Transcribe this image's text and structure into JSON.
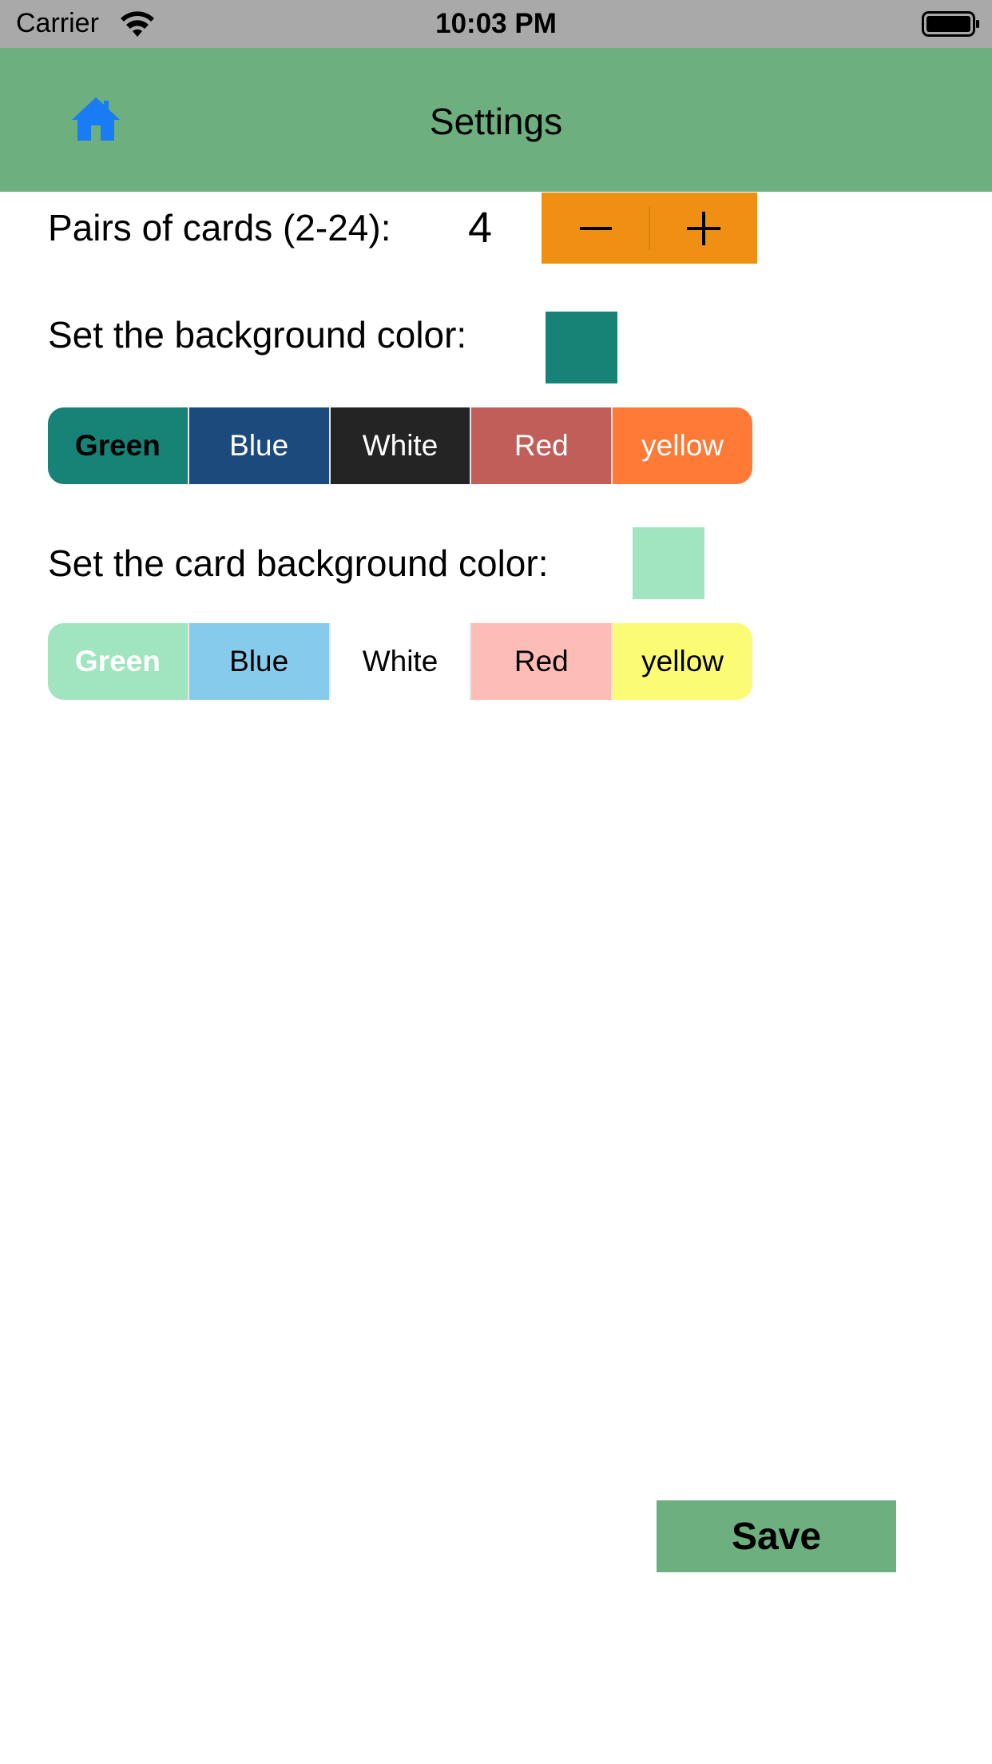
{
  "status_bar": {
    "carrier": "Carrier",
    "time": "10:03 PM",
    "wifi_icon": "wifi-icon",
    "battery_icon": "battery-icon"
  },
  "nav_bar": {
    "title": "Settings",
    "home_icon": "home-icon",
    "background": "#6daf7e",
    "home_icon_color": "#1a7cf5"
  },
  "pairs": {
    "label": "Pairs of cards (2-24):",
    "value": "4",
    "stepper_color": "#ef9014",
    "decrement_icon": "minus-icon",
    "increment_icon": "plus-icon"
  },
  "background_color": {
    "label": "Set the background color:",
    "preview_color": "#178276",
    "selected": "Green",
    "options": [
      {
        "label": "Green",
        "color": "#178276",
        "text_color": "#000000"
      },
      {
        "label": "Blue",
        "color": "#1c4a7d",
        "text_color": "#ffffff"
      },
      {
        "label": "White",
        "color": "#242424",
        "text_color": "#ffffff"
      },
      {
        "label": "Red",
        "color": "#c05f5a",
        "text_color": "#ffffff"
      },
      {
        "label": "yellow",
        "color": "#ff7937",
        "text_color": "#ffffff"
      }
    ]
  },
  "card_background_color": {
    "label": "Set the card background color:",
    "preview_color": "#a0e4c0",
    "selected": "Green",
    "options": [
      {
        "label": "Green",
        "color": "#a0e4c0",
        "text_color": "#ffffff"
      },
      {
        "label": "Blue",
        "color": "#87cbec",
        "text_color": "#000000"
      },
      {
        "label": "White",
        "color": "#ffffff",
        "text_color": "#000000"
      },
      {
        "label": "Red",
        "color": "#fdbcb5",
        "text_color": "#000000"
      },
      {
        "label": "yellow",
        "color": "#fcfc74",
        "text_color": "#000000"
      }
    ]
  },
  "save_button": {
    "label": "Save",
    "color": "#6daf7e"
  }
}
